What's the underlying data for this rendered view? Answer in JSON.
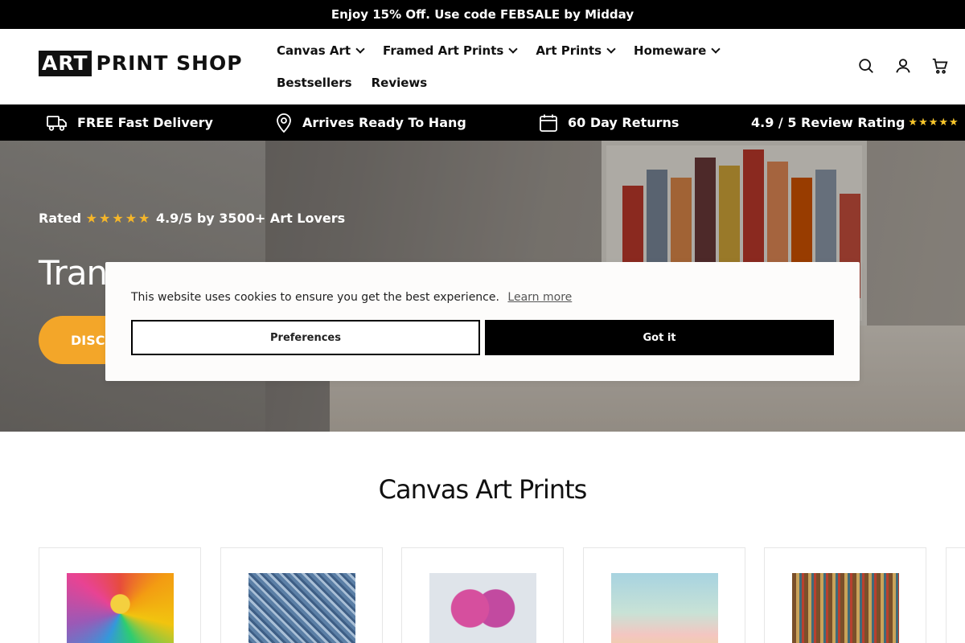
{
  "announcement": "Enjoy 15% Off. Use code FEBSALE by Midday",
  "logo": {
    "box_text": "ART",
    "text": "PRINT SHOP"
  },
  "nav": [
    {
      "label": "Canvas Art",
      "has_dropdown": true
    },
    {
      "label": "Framed Art Prints",
      "has_dropdown": true
    },
    {
      "label": "Art Prints",
      "has_dropdown": true
    },
    {
      "label": "Homeware",
      "has_dropdown": true
    },
    {
      "label": "Bestsellers",
      "has_dropdown": false
    },
    {
      "label": "Reviews",
      "has_dropdown": false
    }
  ],
  "header_icons": [
    "search-icon",
    "account-icon",
    "cart-icon"
  ],
  "usp": [
    {
      "icon": "truck-icon",
      "label": "FREE Fast Delivery"
    },
    {
      "icon": "location-pin-icon",
      "label": "Arrives Ready To Hang"
    },
    {
      "icon": "calendar-icon",
      "label": "60 Day Returns"
    },
    {
      "icon": "",
      "label": "4.9 / 5 Review Rating",
      "stars": "★★★★★"
    }
  ],
  "hero": {
    "rated_prefix": "Rated",
    "rated_stars": "★★★★★",
    "rated_suffix": "4.9/5 by 3500+ Art Lovers",
    "title": "Trans",
    "button": "DISCO"
  },
  "cookie_banner": {
    "message": "This website uses cookies to ensure you get the best experience.",
    "learn_more": "Learn more",
    "preferences": "Preferences",
    "accept": "Got it"
  },
  "section_title": "Canvas Art Prints",
  "products": [
    {
      "art": "colorful-tree"
    },
    {
      "art": "blue-city"
    },
    {
      "art": "pink-heart"
    },
    {
      "art": "pastel-flowers"
    },
    {
      "art": "abstract-city"
    },
    {
      "art": "partial"
    }
  ],
  "colors": {
    "accent": "#f3a629",
    "star": "#f7c52b",
    "black": "#000000"
  }
}
